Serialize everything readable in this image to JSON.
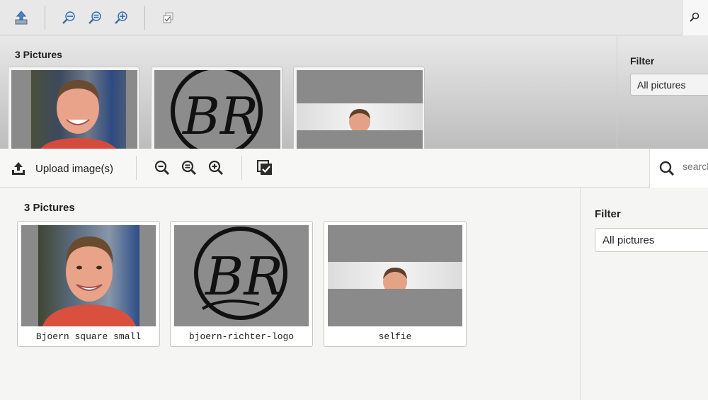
{
  "old": {
    "count_label": "3 Pictures",
    "filter_label": "Filter",
    "filter_value": "All pictures",
    "icons": [
      "upload-icon",
      "zoom-out-icon",
      "zoom-reset-icon",
      "zoom-in-icon",
      "select-all-icon",
      "search-icon"
    ]
  },
  "new": {
    "upload_label": "Upload image(s)",
    "search_placeholder": "search",
    "count_label": "3 Pictures",
    "filter_label": "Filter",
    "filter_value": "All pictures",
    "pictures": [
      {
        "name": "Bjoern square small",
        "kind": "portrait"
      },
      {
        "name": "bjoern-richter-logo",
        "kind": "logo"
      },
      {
        "name": "selfie",
        "kind": "selfie"
      }
    ]
  },
  "colors": {
    "old_bg": "#e8e8e8",
    "new_bg": "#f5f5f3",
    "thumbnail_bg": "#8a8a8a",
    "icon_blue": "#2f5f9e",
    "text": "#222222"
  }
}
